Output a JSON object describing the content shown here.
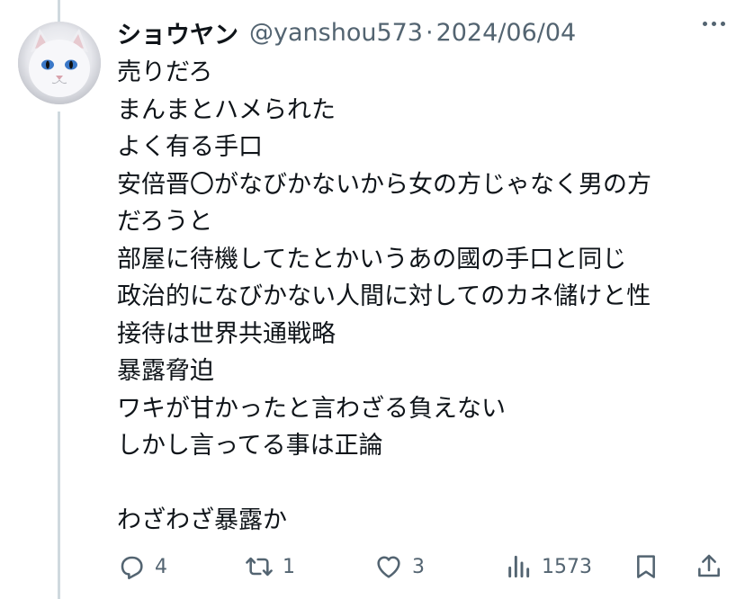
{
  "tweet": {
    "display_name": "ショウヤン",
    "handle": "@yanshou573",
    "separator": "·",
    "date": "2024/06/04",
    "lines": [
      "売りだろ",
      "まんまとハメられた",
      "よく有る手口",
      "安倍晋〇がなびかないから女の方じゃなく男の方",
      "だろうと",
      "部屋に待機してたとかいうあの國の手口と同じ",
      "政治的になびかない人間に対してのカネ儲けと性",
      "接待は世界共通戦略",
      "暴露脅迫",
      "ワキが甘かったと言わざる負えない",
      "しかし言ってる事は正論",
      "",
      "わざわざ暴露か"
    ]
  },
  "actions": {
    "reply_count": "4",
    "repost_count": "1",
    "like_count": "3",
    "views_count": "1573"
  },
  "colors": {
    "text": "#0f1419",
    "secondary": "#536471",
    "thread_line": "#cfd9de"
  },
  "icons": [
    "more-icon",
    "reply-icon",
    "repost-icon",
    "like-icon",
    "views-icon",
    "bookmark-icon",
    "share-icon"
  ]
}
